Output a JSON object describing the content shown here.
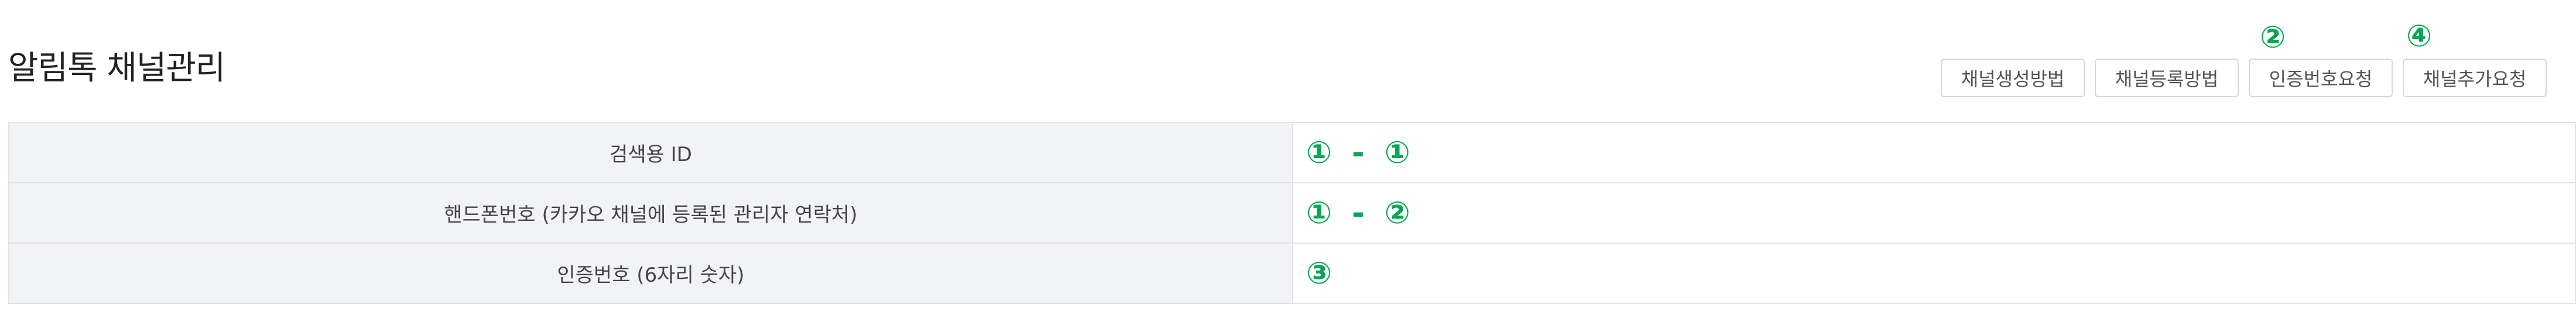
{
  "header": {
    "title": "알림톡 채널관리"
  },
  "toolbar": {
    "buttons": [
      {
        "label": "채널생성방법"
      },
      {
        "label": "채널등록방법"
      },
      {
        "label": "인증번호요청"
      },
      {
        "label": "채널추가요청"
      }
    ],
    "annotations": [
      "②",
      "④"
    ]
  },
  "form": {
    "rows": [
      {
        "label": "검색용 ID",
        "marks": [
          "①",
          "-",
          "①"
        ]
      },
      {
        "label": "핸드폰번호 (카카오 채널에 등록된 관리자 연락처)",
        "marks": [
          "①",
          "-",
          "②"
        ]
      },
      {
        "label": "인증번호 (6자리 숫자)",
        "marks": [
          "③"
        ]
      }
    ]
  },
  "colors": {
    "annotation": "#00a651",
    "label_background": "#f2f3f6",
    "border": "#e3e3e6"
  }
}
